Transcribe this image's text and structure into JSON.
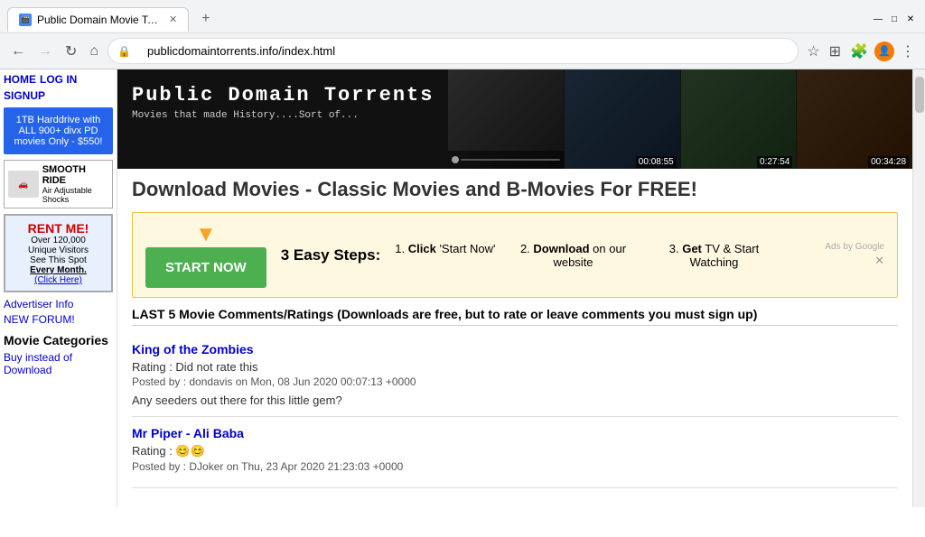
{
  "browser": {
    "tab_title": "Public Domain Movie Torrents w...",
    "tab_favicon": "🎬",
    "url": "publicdomaintorrents.info/index.html",
    "new_tab_icon": "+",
    "back_icon": "←",
    "forward_icon": "→",
    "refresh_icon": "↻",
    "home_icon": "⌂"
  },
  "sidebar": {
    "nav_items": [
      {
        "label": "HOME",
        "href": "#"
      },
      {
        "label": "LOG IN",
        "href": "#"
      },
      {
        "label": "SIGNUP",
        "href": "#"
      }
    ],
    "top_ad": {
      "text": "1TB Harddrive with ALL 900+ divx PD movies Only - $550!"
    },
    "smooth_ride": {
      "title": "SMOOTH RIDE",
      "subtitle": "Air Adjustable Shocks"
    },
    "rent_me": {
      "title": "RENT ME!",
      "line1": "Over 120,000",
      "line2": "Unique Visitors",
      "line3": "See This Spot",
      "line4": "Every Month.",
      "link": "(Click Here)"
    },
    "bottom_links": [
      {
        "label": "Advertiser Info",
        "href": "#"
      },
      {
        "label": "NEW FORUM!",
        "href": "#"
      }
    ],
    "categories_heading": "Movie Categories",
    "categories_links": [
      {
        "label": "Buy instead of Download",
        "href": "#"
      }
    ]
  },
  "banner": {
    "title": "Public Domain Torrents",
    "subtitle": "Movies that made History....Sort of...",
    "images": [
      {
        "timestamp": ""
      },
      {
        "timestamp": "00:08:55"
      },
      {
        "timestamp": "0:27:54"
      },
      {
        "timestamp": "00:34:28"
      }
    ]
  },
  "main": {
    "page_title": "Download Movies - Classic Movies and B-Movies For FREE!",
    "ad": {
      "step1_label": "1.",
      "step1_bold": "Click",
      "step1_text": "'Start Now'",
      "step2_label": "2.",
      "step2_bold": "Download",
      "step2_text": "on our website",
      "step3_label": "3.",
      "step3_bold": "Get",
      "step3_text": "TV & Start Watching",
      "easy_steps": "3 Easy Steps:",
      "start_now": "START NOW",
      "ad_label": "Ads by Google",
      "ad_x": "✕"
    },
    "comments_heading": "LAST 5 Movie Comments/Ratings",
    "comments_note": "(Downloads are free, but to rate or leave comments you must sign up)",
    "comments": [
      {
        "movie": "King of the Zombies",
        "rating_text": "Rating : Did not rate this",
        "posted": "Posted by : dondavis on Mon, 08 Jun 2020 00:07:13 +0000",
        "text": "Any seeders out there for this little gem?"
      },
      {
        "movie": "Mr Piper - Ali Baba",
        "rating_text": "Rating : 😊😊",
        "posted": "Posted by : DJoker on Thu, 23 Apr 2020 21:23:03 +0000",
        "text": ""
      }
    ]
  }
}
